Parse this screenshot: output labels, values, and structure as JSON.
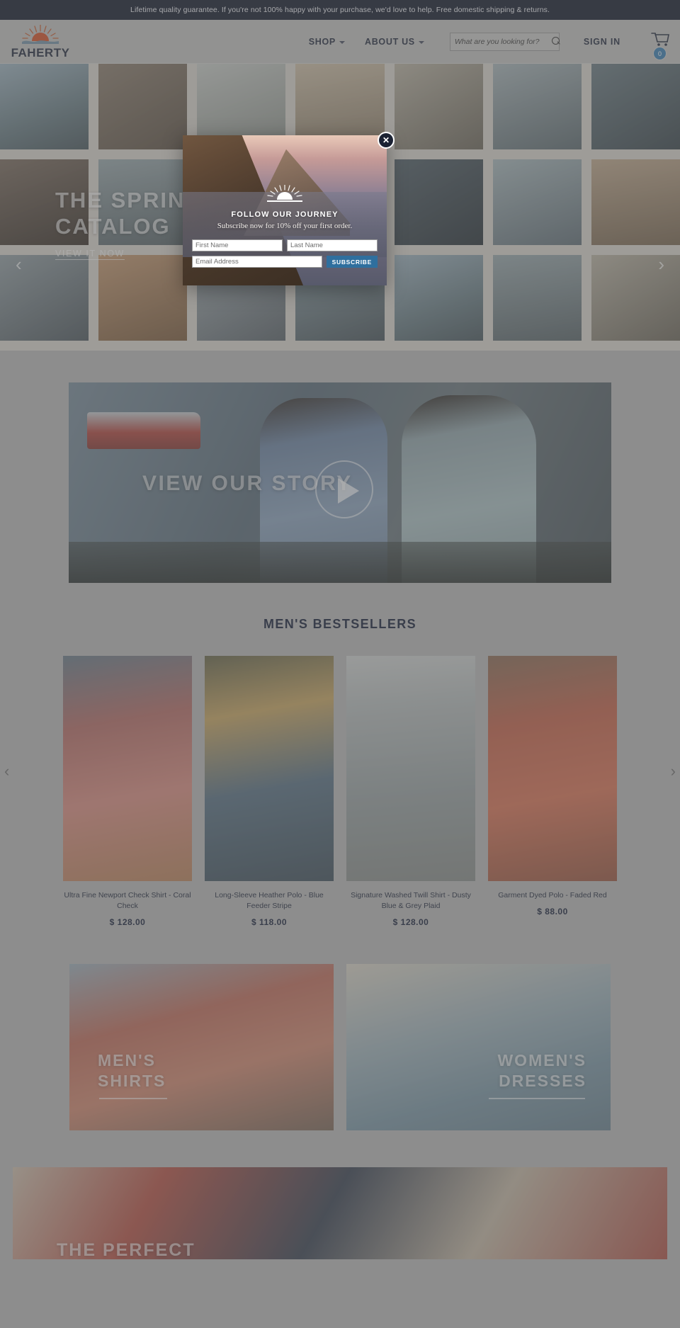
{
  "announcement": {
    "text": "Lifetime quality guarantee. If you're not 100% happy with your purchase, we'd love to help. Free domestic shipping & returns."
  },
  "header": {
    "brand": "FAHERTY",
    "nav": [
      {
        "label": "SHOP",
        "icon": "chevron-down-icon"
      },
      {
        "label": "ABOUT US",
        "icon": "chevron-down-icon"
      }
    ],
    "search": {
      "placeholder": "What are you looking for?",
      "value": "",
      "icon": "search-icon"
    },
    "sign_in": "SIGN IN",
    "cart": {
      "icon": "cart-icon",
      "count": "0",
      "badge_color": "#3f82b4"
    }
  },
  "hero": {
    "title_line1": "THE SPRING",
    "title_line2": "CATALOG",
    "cta": "VIEW IT NOW",
    "prev_arrow": "‹",
    "next_arrow": "›"
  },
  "story": {
    "label": "VIEW OUR STORY",
    "play_icon": "play-icon"
  },
  "bestsellers": {
    "title": "MEN'S BESTSELLERS",
    "prev_arrow": "‹",
    "next_arrow": "›",
    "products": [
      {
        "name": "Ultra Fine Newport Check Shirt - Coral Check",
        "price": "$ 128.00"
      },
      {
        "name": "Long-Sleeve Heather Polo - Blue Feeder Stripe",
        "price": "$ 118.00"
      },
      {
        "name": "Signature Washed Twill Shirt - Dusty Blue & Grey Plaid",
        "price": "$ 128.00"
      },
      {
        "name": "Garment Dyed Polo - Faded Red",
        "price": "$ 88.00"
      }
    ]
  },
  "categories": [
    {
      "line1": "MEN'S",
      "line2": "SHIRTS"
    },
    {
      "line1": "WOMEN'S",
      "line2": "DRESSES"
    }
  ],
  "bottom_banner": {
    "label": "THE PERFECT"
  },
  "modal": {
    "title": "FOLLOW OUR JOURNEY",
    "subtitle": "Subscribe now for 10% off your first order.",
    "first_name_placeholder": "First Name",
    "last_name_placeholder": "Last Name",
    "email_placeholder": "Email Address",
    "submit_label": "SUBSCRIBE",
    "close_icon": "close-icon",
    "logo_icon": "sunrise-icon",
    "submit_color": "#2f6f9e"
  }
}
